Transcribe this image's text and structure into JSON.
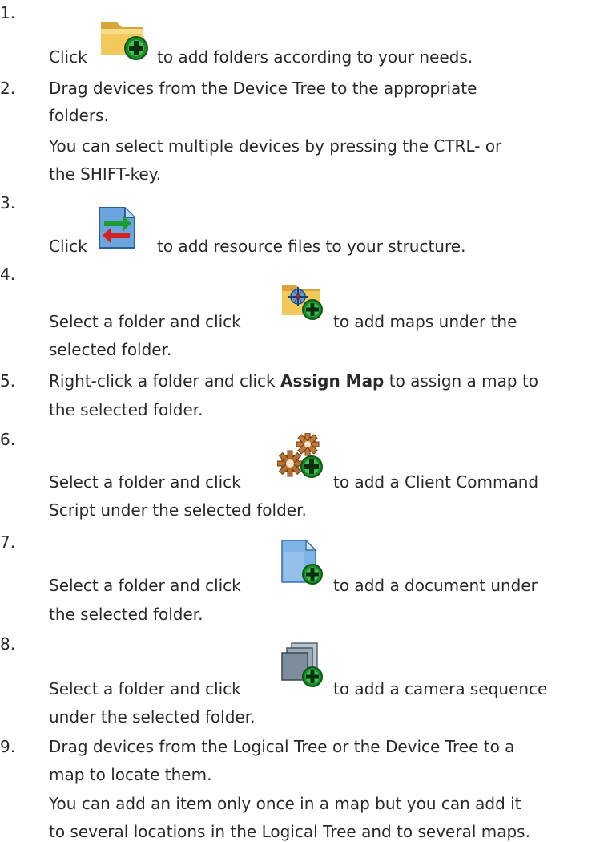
{
  "steps": [
    {
      "num": "1.",
      "pre": "Click",
      "post": "to add folders according to your needs.",
      "icon": "folder-add-icon"
    },
    {
      "num": "2.",
      "lines": [
        "Drag devices from the Device Tree to the appropriate",
        "folders.",
        "You can select multiple devices by pressing the CTRL- or",
        "the SHIFT-key."
      ]
    },
    {
      "num": "3.",
      "pre": "Click",
      "post": "to add resource files to your structure.",
      "icon": "resource-file-icon"
    },
    {
      "num": "4.",
      "pre": "Select a folder and click",
      "post": "to add maps under the",
      "cont": "selected folder.",
      "icon": "map-add-icon"
    },
    {
      "num": "5.",
      "pre": "Right-click a folder and click",
      "bold": "Assign Map",
      "post": "to assign a map to",
      "cont": "the selected folder."
    },
    {
      "num": "6.",
      "pre": "Select a folder and click",
      "post": "to add a Client Command",
      "cont": "Script under the selected folder.",
      "icon": "gears-add-icon"
    },
    {
      "num": "7.",
      "pre": "Select a folder and click",
      "post": "to add a document under",
      "cont": "the selected folder.",
      "icon": "document-add-icon"
    },
    {
      "num": "8.",
      "pre": "Select a folder and click",
      "post": "to add a camera sequence",
      "cont": "under the selected folder.",
      "icon": "sequence-add-icon"
    },
    {
      "num": "9.",
      "lines": [
        "Drag devices from the Logical Tree or the Device Tree to a",
        "map to locate them.",
        "You can add an item only once in a map but you can add it",
        "to several locations in the Logical Tree and to several maps."
      ]
    }
  ]
}
